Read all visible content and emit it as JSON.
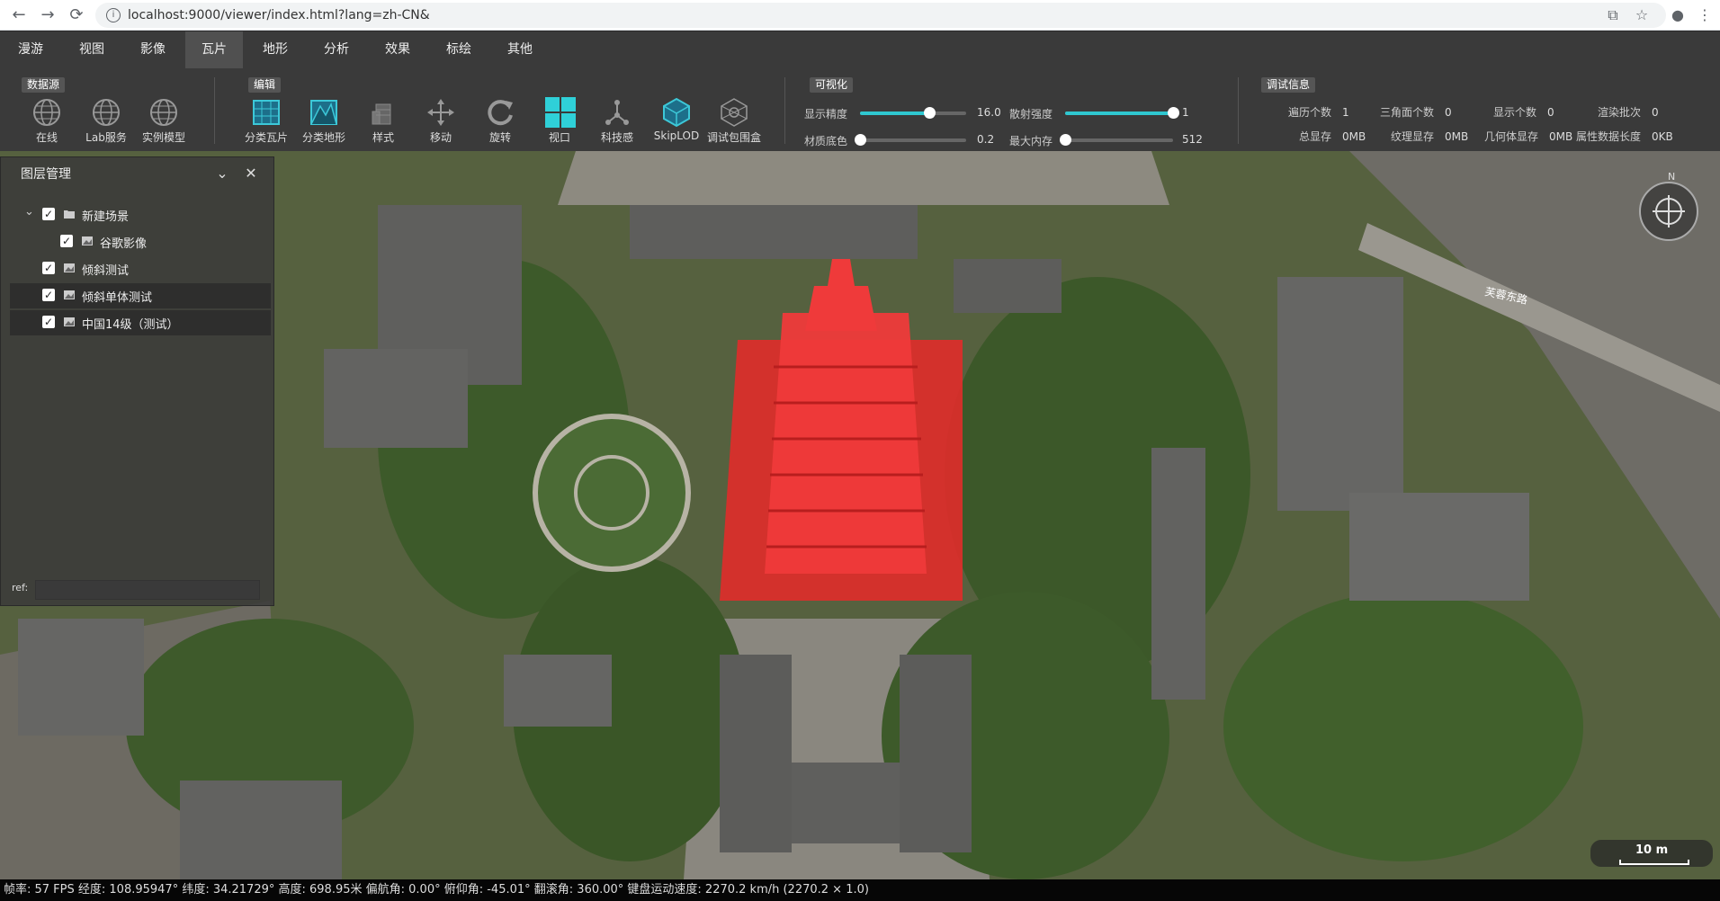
{
  "browser": {
    "url": "localhost:9000/viewer/index.html?lang=zh-CN&"
  },
  "menu": {
    "items": [
      "漫游",
      "视图",
      "影像",
      "瓦片",
      "地形",
      "分析",
      "效果",
      "标绘",
      "其他"
    ],
    "active": "瓦片"
  },
  "ribbon": {
    "groups": {
      "datasource": "数据源",
      "edit": "编辑",
      "visual": "可视化",
      "debug": "调试信息"
    },
    "datasource_tools": [
      "在线",
      "Lab服务",
      "实例模型"
    ],
    "edit_tools": [
      "分类瓦片",
      "分类地形",
      "样式",
      "移动",
      "旋转",
      "视口",
      "科技感",
      "SkipLOD",
      "调试包围盒"
    ],
    "sliders": {
      "precision": {
        "label": "显示精度",
        "value": "16.0",
        "fraction": 0.65
      },
      "scatter": {
        "label": "散射强度",
        "value": "1",
        "fraction": 1.0
      },
      "base_color": {
        "label": "材质底色",
        "value": "0.2",
        "fraction": 0.0
      },
      "max_memory": {
        "label": "最大内存",
        "value": "512",
        "fraction": 0.0
      }
    },
    "debug": {
      "traverse_count": {
        "label": "遍历个数",
        "value": "1"
      },
      "triangle_count": {
        "label": "三角面个数",
        "value": "0"
      },
      "display_count": {
        "label": "显示个数",
        "value": "0"
      },
      "render_batches": {
        "label": "渲染批次",
        "value": "0"
      },
      "total_memory": {
        "label": "总显存",
        "value": "0MB"
      },
      "texture_memory": {
        "label": "纹理显存",
        "value": "0MB"
      },
      "geometry_memory": {
        "label": "几何体显存",
        "value": "0MB"
      },
      "attribute_length": {
        "label": "属性数据长度",
        "value": "0KB"
      }
    }
  },
  "layer_panel": {
    "title": "图层管理",
    "root": "新建场景",
    "layers": [
      "谷歌影像",
      "倾斜测试",
      "倾斜单体测试",
      "中国14级（测试）"
    ],
    "ref_label": "ref:"
  },
  "map": {
    "compass_label": "N",
    "road_label": "芙蓉东路",
    "scale_label": "10 m",
    "highlight_color": "#e52a2a"
  },
  "statusbar": {
    "text": "帧率: 57 FPS 经度: 108.95947° 纬度: 34.21729° 高度: 698.95米 偏航角: 0.00° 俯仰角: -45.01° 翻滚角: 360.00° 键盘运动速度: 2270.2 km/h (2270.2 × 1.0)"
  }
}
